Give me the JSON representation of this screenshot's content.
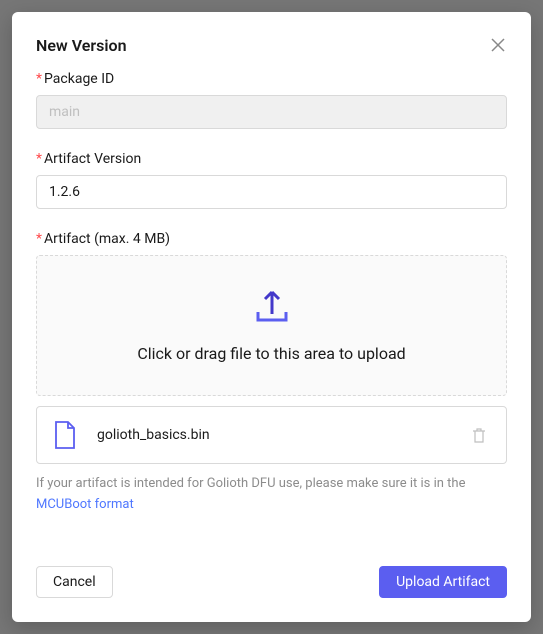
{
  "modal": {
    "title": "New Version",
    "packageId": {
      "label": "Package ID",
      "placeholder": "main",
      "value": ""
    },
    "artifactVersion": {
      "label": "Artifact Version",
      "value": "1.2.6"
    },
    "artifact": {
      "label": "Artifact (max. 4 MB)",
      "uploadText": "Click or drag file to this area to upload",
      "fileName": "golioth_basics.bin"
    },
    "hint": {
      "prefix": "If your artifact is intended for Golioth DFU use, please make sure it is in the ",
      "linkText": "MCUBoot format"
    },
    "buttons": {
      "cancel": "Cancel",
      "upload": "Upload Artifact"
    }
  }
}
